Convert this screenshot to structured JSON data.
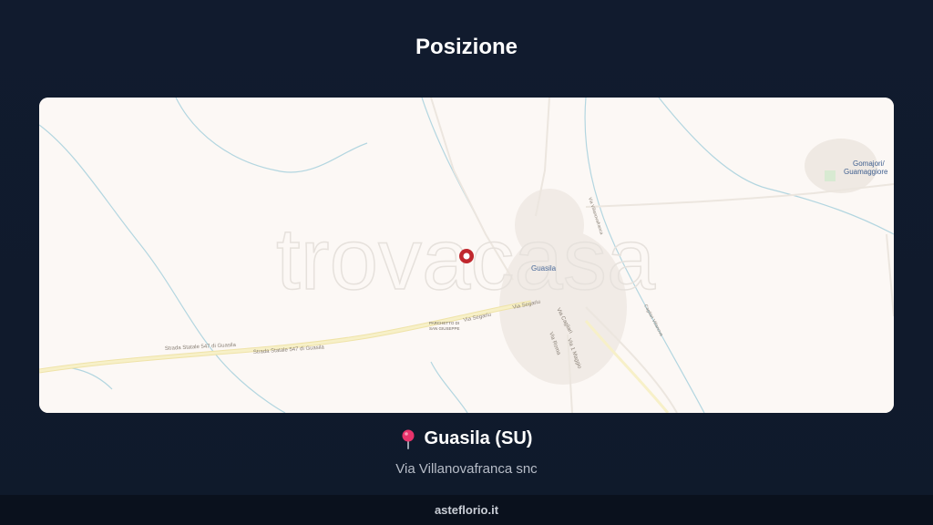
{
  "header": {
    "title": "Posizione"
  },
  "map": {
    "watermark": "trovacasa",
    "town_label": "Guasila",
    "place_label_1": "Gomajori/",
    "place_label_2": "Guamaggiore",
    "road_label_1": "Strada Statale 547 di Guasila",
    "road_label_2": "Strada Statale 547 di Guasila",
    "road_label_3": "Via Segariu",
    "road_label_4": "Via Segariu",
    "road_label_5": "Via Cagliari",
    "road_label_6": "Via Roma",
    "road_label_7": "Via 1 Maggio",
    "road_label_8": "Via Villanovafranca",
    "road_label_9": "Cagliari Villanova",
    "poi_label_1": "PARCHETTO DI",
    "poi_label_2": "SAN GIUSEPPE",
    "marker_icon": "location-marker-icon",
    "colors": {
      "marker": "#c0272d",
      "background": "#fcf8f5",
      "road": "#f6eebe",
      "water": "#a9d3df"
    }
  },
  "location": {
    "pin_icon": "pin-icon",
    "title": "Guasila (SU)",
    "address": "Via Villanovafranca snc"
  },
  "footer": {
    "brand": "asteflorio.it"
  }
}
